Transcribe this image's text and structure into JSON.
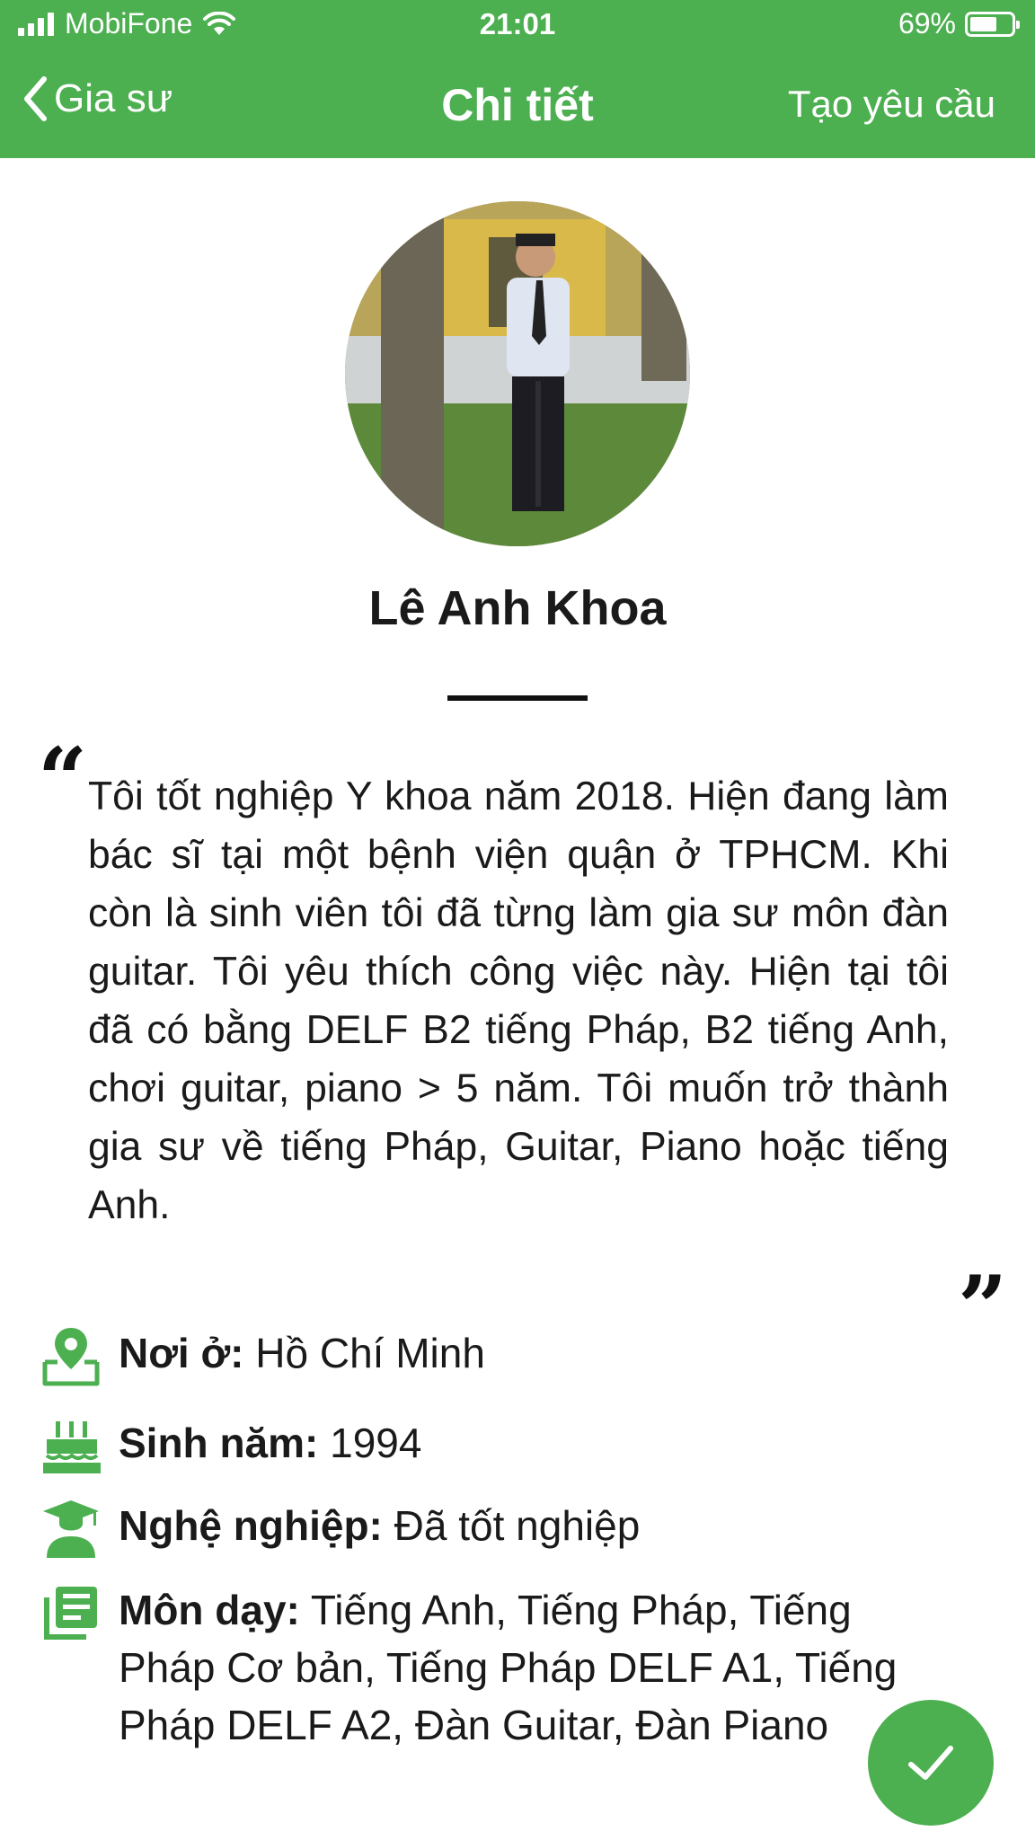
{
  "status_bar": {
    "carrier": "MobiFone",
    "time": "21:01",
    "battery": "69%",
    "battery_level": 0.69,
    "signal_bars": 4
  },
  "nav": {
    "back_label": "Gia sư",
    "title": "Chi tiết",
    "action_label": "Tạo yêu cầu"
  },
  "profile": {
    "name": "Lê Anh Khoa",
    "bio": "Tôi tốt nghiệp Y khoa năm 2018. Hiện đang làm bác sĩ tại một bệnh viện quận ở TPHCM. Khi còn là sinh viên tôi đã từng làm gia sư môn đàn guitar. Tôi yêu thích công việc này. Hiện tại tôi đã có bằng DELF B2 tiếng Pháp, B2 tiếng Anh, chơi guitar, piano > 5 năm. Tôi muốn trở thành gia sư về tiếng Pháp, Guitar, Piano hoặc tiếng Anh.",
    "quote_open": "“",
    "quote_close": "”"
  },
  "info": [
    {
      "icon": "location-pin-icon",
      "label": "Nơi ở:",
      "value": "Hồ Chí Minh"
    },
    {
      "icon": "birthday-cake-icon",
      "label": "Sinh năm:",
      "value": "1994"
    },
    {
      "icon": "graduate-icon",
      "label": "Nghệ nghiệp:",
      "value": "Đã tốt nghiệp"
    },
    {
      "icon": "subjects-list-icon",
      "label": "Môn dạy:",
      "value": "Tiếng Anh, Tiếng Pháp, Tiếng Pháp Cơ bản, Tiếng Pháp DELF A1, Tiếng Pháp DELF A2, Đàn Guitar, Đàn Piano"
    }
  ],
  "colors": {
    "primary": "#4caf50",
    "text": "#1a1a1a"
  }
}
